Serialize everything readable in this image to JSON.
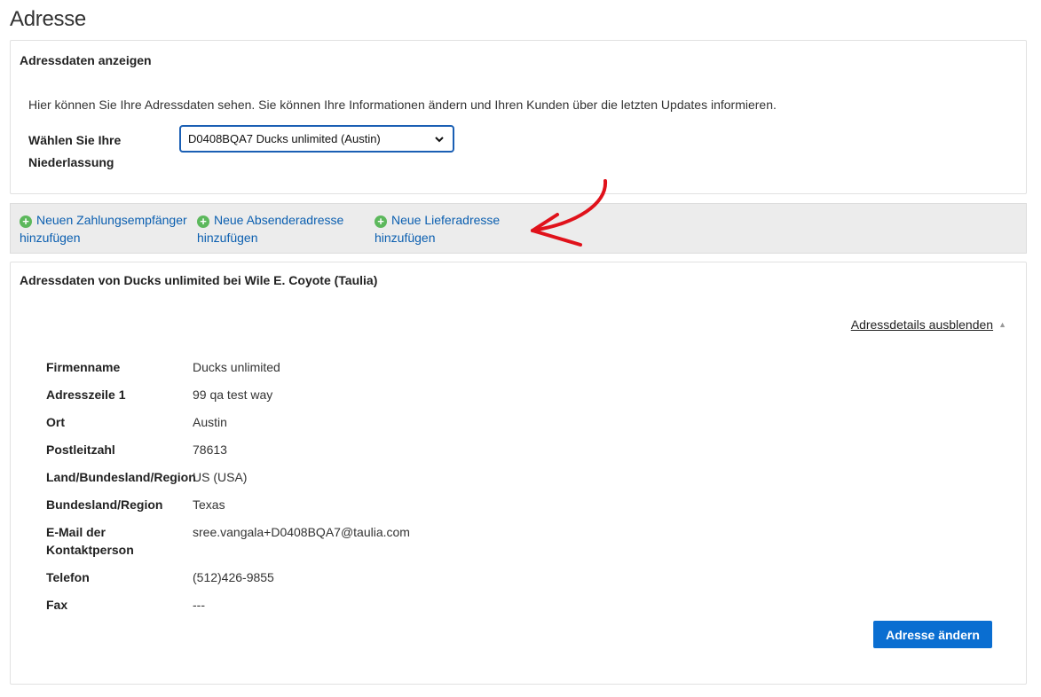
{
  "page": {
    "title": "Adresse"
  },
  "view_panel": {
    "heading": "Adressdaten anzeigen",
    "intro": "Hier können Sie Ihre Adressdaten sehen. Sie können Ihre Informationen ändern und Ihren Kunden über die letzten Updates informieren.",
    "branch_label": "Wählen Sie Ihre Niederlassung",
    "branch_selected": "D0408BQA7 Ducks unlimited (Austin)"
  },
  "actions": [
    {
      "line1": "Neuen Zahlungsempfänger",
      "line2": "hinzufügen"
    },
    {
      "line1": "Neue Absenderadresse",
      "line2": "hinzufügen"
    },
    {
      "line1": "Neue Lieferadresse",
      "line2": "hinzufügen"
    }
  ],
  "annotation": {
    "arrow_color": "#e0121b"
  },
  "details_panel": {
    "heading": "Adressdaten von Ducks unlimited bei Wile E. Coyote (Taulia)",
    "toggle_label": "Adressdetails ausblenden",
    "rows": [
      {
        "label": "Firmenname",
        "value": "Ducks unlimited"
      },
      {
        "label": "Adresszeile 1",
        "value": "99 qa test way"
      },
      {
        "label": "Ort",
        "value": "Austin"
      },
      {
        "label": "Postleitzahl",
        "value": "78613"
      },
      {
        "label": "Land/Bundesland/Region",
        "value": "US (USA)"
      },
      {
        "label": "Bundesland/Region",
        "value": "Texas"
      },
      {
        "label": "E-Mail der Kontaktperson",
        "value": "sree.vangala+D0408BQA7@taulia.com"
      },
      {
        "label": "Telefon",
        "value": "(512)426-9855"
      },
      {
        "label": "Fax",
        "value": "---"
      }
    ],
    "change_button": "Adresse ändern"
  },
  "colors": {
    "primary": "#0a6ed1",
    "link": "#0b5fb0",
    "add_icon": "#5cb85c"
  }
}
